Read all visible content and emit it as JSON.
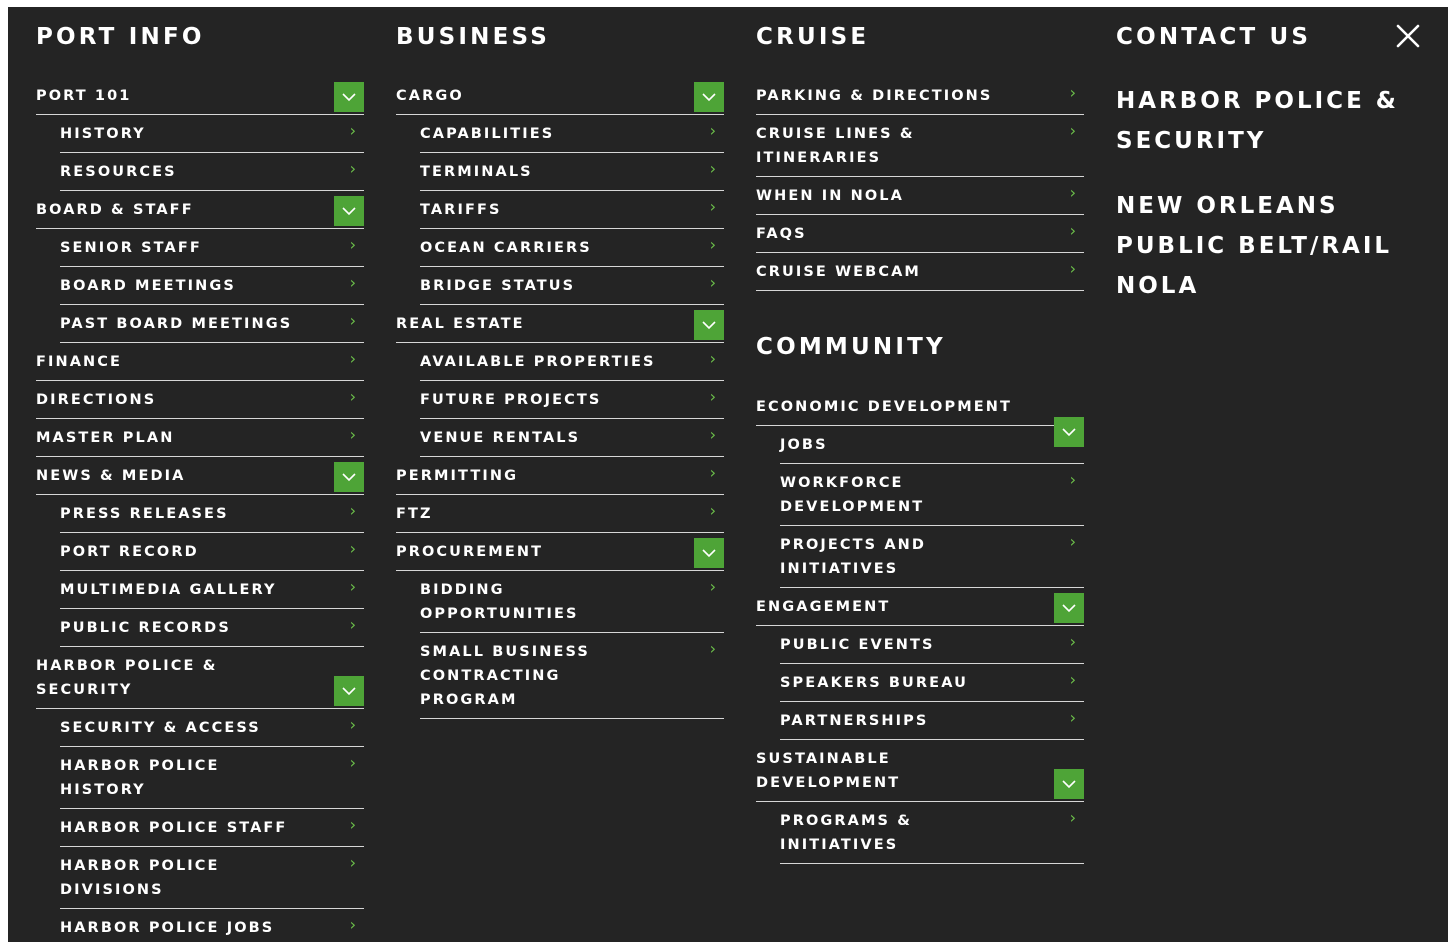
{
  "colors": {
    "panel_bg": "#242424",
    "accent_green": "#4ea437",
    "chevron_green": "#6cc04a",
    "text": "#ffffff",
    "divider": "#d7d7d7"
  },
  "icons": {
    "chevron": "chevron-right-icon",
    "expand": "chevron-down-icon",
    "close": "close-icon"
  },
  "port_info": {
    "title": "PORT INFO",
    "items": [
      {
        "label": "PORT 101"
      },
      {
        "label": "HISTORY"
      },
      {
        "label": "RESOURCES"
      },
      {
        "label": "BOARD & STAFF"
      },
      {
        "label": "SENIOR STAFF"
      },
      {
        "label": "BOARD MEETINGS"
      },
      {
        "label": "PAST BOARD MEETINGS"
      },
      {
        "label": "FINANCE"
      },
      {
        "label": "DIRECTIONS"
      },
      {
        "label": "MASTER PLAN"
      },
      {
        "label": "NEWS & MEDIA"
      },
      {
        "label": "PRESS RELEASES"
      },
      {
        "label": "PORT RECORD"
      },
      {
        "label": "MULTIMEDIA GALLERY"
      },
      {
        "label": "PUBLIC RECORDS"
      },
      {
        "label": "HARBOR POLICE &"
      },
      {
        "label": "SECURITY"
      },
      {
        "label": "SECURITY & ACCESS"
      },
      {
        "label": "HARBOR POLICE"
      },
      {
        "label": "HISTORY"
      },
      {
        "label": "HARBOR POLICE STAFF"
      },
      {
        "label": "HARBOR POLICE"
      },
      {
        "label": "DIVISIONS"
      },
      {
        "label": "HARBOR POLICE JOBS"
      }
    ]
  },
  "business": {
    "title": "BUSINESS",
    "items": [
      {
        "label": "CARGO"
      },
      {
        "label": "CAPABILITIES"
      },
      {
        "label": "TERMINALS"
      },
      {
        "label": "TARIFFS"
      },
      {
        "label": "OCEAN CARRIERS"
      },
      {
        "label": "BRIDGE STATUS"
      },
      {
        "label": "REAL ESTATE"
      },
      {
        "label": "AVAILABLE PROPERTIES"
      },
      {
        "label": "FUTURE PROJECTS"
      },
      {
        "label": "VENUE RENTALS"
      },
      {
        "label": "PERMITTING"
      },
      {
        "label": "FTZ"
      },
      {
        "label": "PROCUREMENT"
      },
      {
        "label": "BIDDING"
      },
      {
        "label": "OPPORTUNITIES"
      },
      {
        "label": "SMALL BUSINESS"
      },
      {
        "label": "CONTRACTING"
      },
      {
        "label": "PROGRAM"
      }
    ]
  },
  "cruise": {
    "title": "CRUISE",
    "items": [
      {
        "label": "PARKING & DIRECTIONS"
      },
      {
        "label": "CRUISE LINES &"
      },
      {
        "label": "ITINERARIES"
      },
      {
        "label": "WHEN IN NOLA"
      },
      {
        "label": "FAQS"
      },
      {
        "label": "CRUISE WEBCAM"
      }
    ]
  },
  "community": {
    "title": "COMMUNITY",
    "items": [
      {
        "label": "ECONOMIC DEVELOPMENT"
      },
      {
        "label": "JOBS"
      },
      {
        "label": "WORKFORCE"
      },
      {
        "label": "DEVELOPMENT"
      },
      {
        "label": "PROJECTS AND"
      },
      {
        "label": "INITIATIVES"
      },
      {
        "label": "ENGAGEMENT"
      },
      {
        "label": "PUBLIC EVENTS"
      },
      {
        "label": "SPEAKERS BUREAU"
      },
      {
        "label": "PARTNERSHIPS"
      },
      {
        "label": "SUSTAINABLE"
      },
      {
        "label": "DEVELOPMENT"
      },
      {
        "label": "PROGRAMS &"
      },
      {
        "label": "INITIATIVES"
      }
    ]
  },
  "contact": {
    "title": "CONTACT US",
    "links": [
      {
        "label": "HARBOR POLICE &"
      },
      {
        "label": "SECURITY"
      },
      {
        "label": "NEW ORLEANS"
      },
      {
        "label": "PUBLIC BELT/RAIL"
      },
      {
        "label": "NOLA"
      }
    ]
  }
}
